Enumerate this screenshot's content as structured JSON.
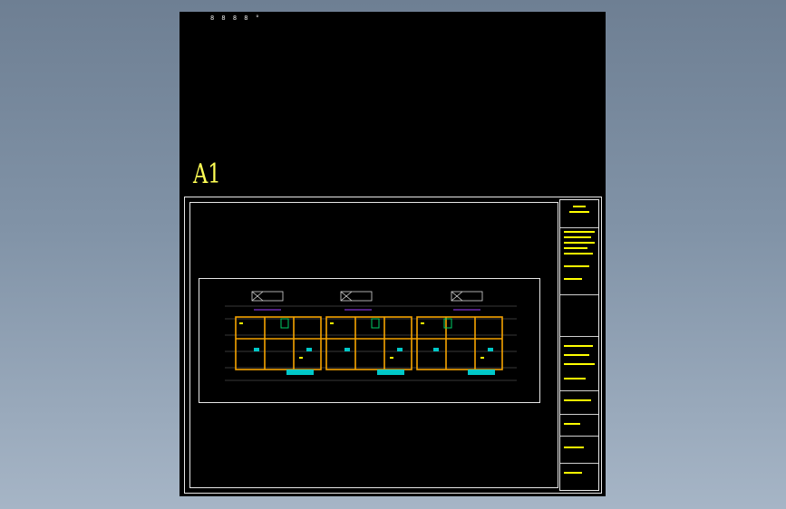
{
  "drawing": {
    "top_label": "8 8 8 8 °",
    "sheet_size": "A1"
  },
  "colors": {
    "background_top": "#6e7f93",
    "background_bottom": "#a6b5c6",
    "paper": "#000000",
    "frame": "#e8e8e8",
    "walls": "#f5a300",
    "annotations": "#ffff00",
    "grid": "#9a9a9a",
    "fixtures": "#00cc66",
    "accent": "#a040ff",
    "pipes": "#00c8c8"
  }
}
